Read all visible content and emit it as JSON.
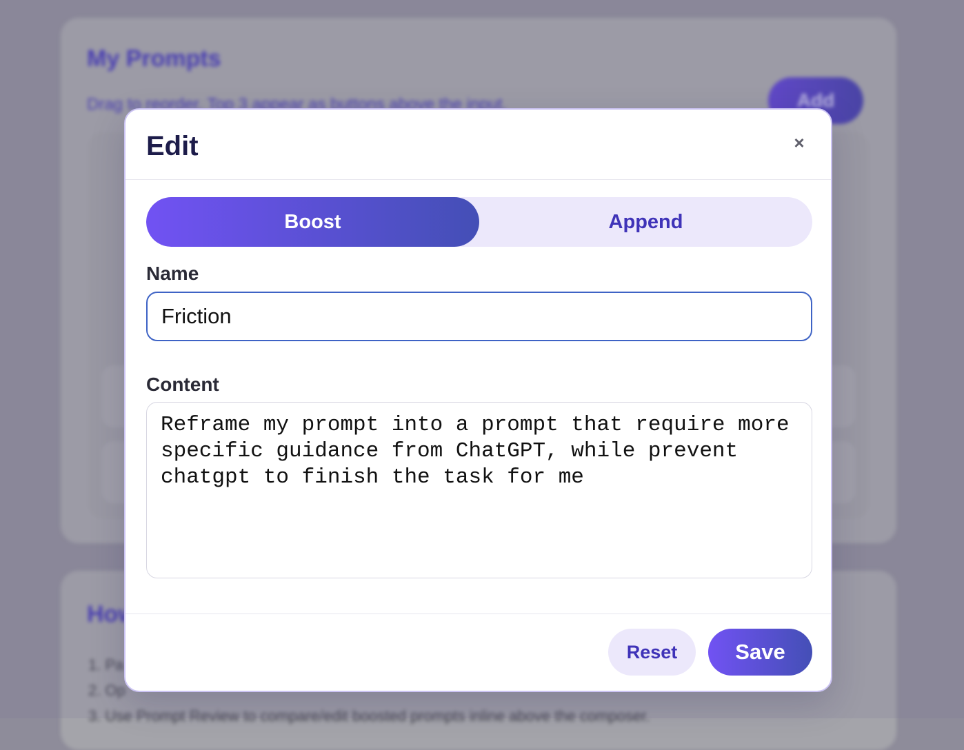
{
  "background": {
    "title": "My Prompts",
    "subtitle": "Drag to reorder. Top 3 appear as buttons above the input.",
    "add_label": "Add",
    "section2_title": "How",
    "steps": [
      "1. Pa",
      "2. Op",
      "3. Use Prompt Review to compare/edit boosted prompts inline above the composer."
    ]
  },
  "modal": {
    "title": "Edit",
    "close_icon": "×",
    "tabs": [
      {
        "label": "Boost",
        "active": true
      },
      {
        "label": "Append",
        "active": false
      }
    ],
    "name_label": "Name",
    "name_value": "Friction",
    "content_label": "Content",
    "content_value": "Reframe my prompt into a prompt that require more specific guidance from ChatGPT, while prevent chatgpt to finish the task for me",
    "reset_label": "Reset",
    "save_label": "Save"
  },
  "colors": {
    "accent_start": "#7152f3",
    "accent_end": "#444fb6",
    "accent_text": "#3f33b8",
    "focus_border": "#3e63c5"
  }
}
